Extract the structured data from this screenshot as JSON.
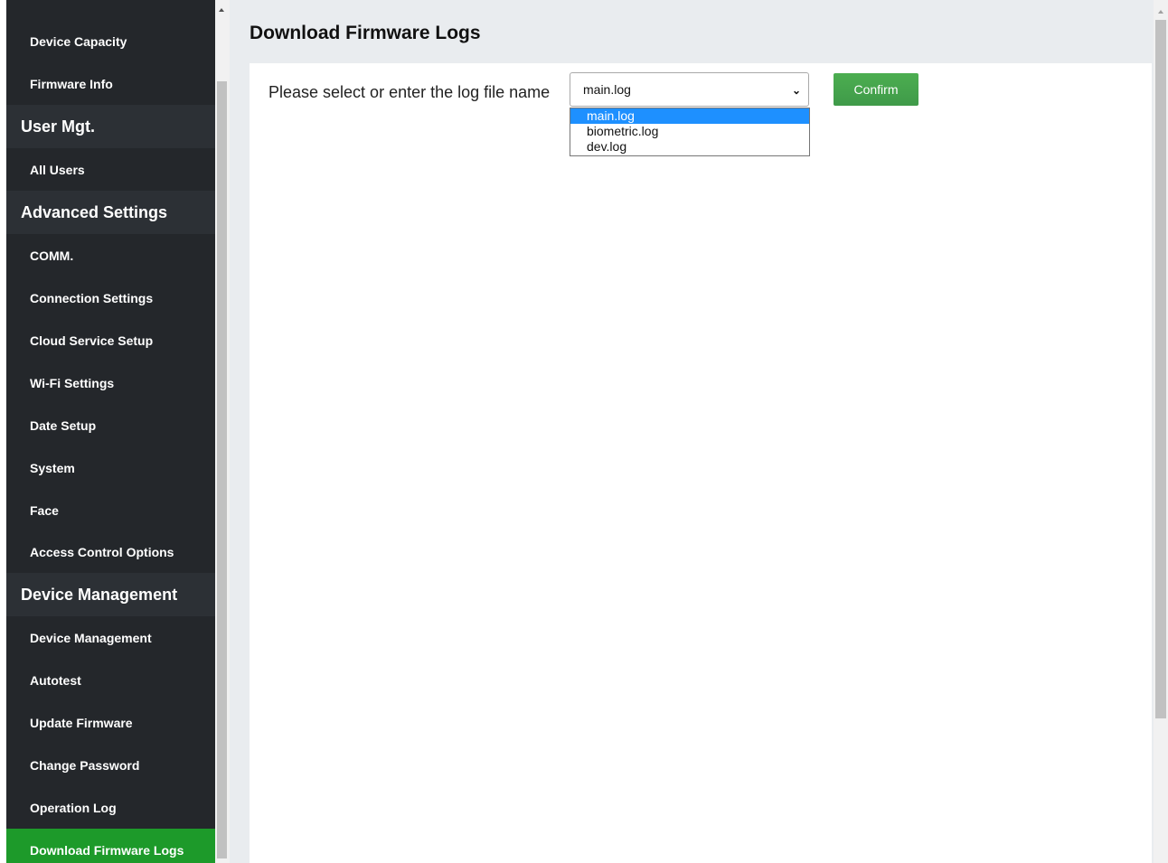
{
  "sidebar": {
    "items": [
      {
        "label": "Device Capacity"
      },
      {
        "label": "Firmware Info"
      },
      {
        "label": "User Mgt."
      },
      {
        "label": "All Users"
      },
      {
        "label": "Advanced Settings"
      },
      {
        "label": "COMM."
      },
      {
        "label": "Connection Settings"
      },
      {
        "label": "Cloud Service Setup"
      },
      {
        "label": "Wi-Fi Settings"
      },
      {
        "label": "Date Setup"
      },
      {
        "label": "System"
      },
      {
        "label": "Face"
      },
      {
        "label": "Access Control Options"
      },
      {
        "label": "Device Management"
      },
      {
        "label": "Device Management"
      },
      {
        "label": "Autotest"
      },
      {
        "label": "Update Firmware"
      },
      {
        "label": "Change Password"
      },
      {
        "label": "Operation Log"
      },
      {
        "label": "Download Firmware Logs"
      }
    ]
  },
  "main": {
    "title": "Download Firmware Logs",
    "log_label": "Please select or enter the log file name",
    "selected_log": "main.log",
    "options": [
      "main.log",
      "biometric.log",
      "dev.log"
    ],
    "confirm_label": "Confirm"
  },
  "colors": {
    "sidebar_bg": "#24272b",
    "section_bg": "#2c3035",
    "active_item": "#1d9a2a",
    "confirm_button": "#45a64c",
    "selected_option": "#1e90ff"
  },
  "icons": {
    "dropdown": "chevron-down-icon",
    "scroll_up": "scroll-up-arrow-icon"
  }
}
